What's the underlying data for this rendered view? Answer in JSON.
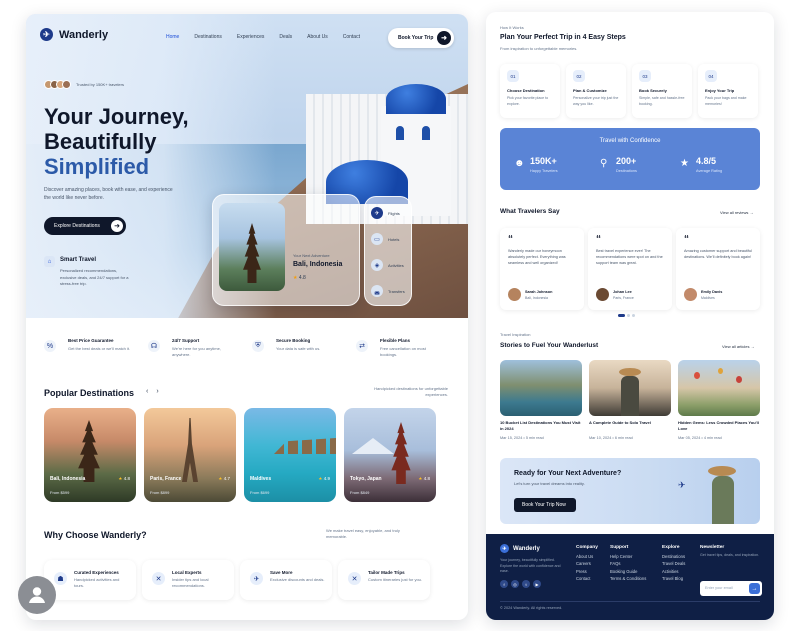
{
  "brand": {
    "name": "Wanderly",
    "accent": "#1e3a8a",
    "hero_accent": "#2c5aa8",
    "dark": "#0f172a",
    "footer_bg": "#0f1f45"
  },
  "nav": {
    "links": [
      "Home",
      "Destinations",
      "Experiences",
      "Deals",
      "About Us",
      "Contact"
    ],
    "cta": "Book Your Trip"
  },
  "hero": {
    "trusted": "Trusted by 150K+ travelers",
    "title_line1": "Your Journey,",
    "title_line2": "Beautifully",
    "title_accent": "Simplified",
    "subtitle": "Discover amazing places, book with ease, and experience the world like never before.",
    "button": "Explore Destinations"
  },
  "smart": {
    "title": "Smart Travel",
    "desc": "Personalized recommendations, exclusive deals, and 24/7 support for a stress-free trip."
  },
  "featured": {
    "label": "Your Next Adventure",
    "name": "Bali, Indonesia",
    "rating": "4.8"
  },
  "side_menu": [
    {
      "label": "Flights",
      "icon": "plane-icon"
    },
    {
      "label": "Hotels",
      "icon": "bed-icon"
    },
    {
      "label": "Activities",
      "icon": "ticket-icon"
    },
    {
      "label": "Transfers",
      "icon": "car-icon"
    }
  ],
  "features": [
    {
      "title": "Best Price Guarantee",
      "desc": "Get the best deals or we'll match it.",
      "icon": "%"
    },
    {
      "title": "24/7 Support",
      "desc": "We're here for you anytime, anywhere.",
      "icon": "☊"
    },
    {
      "title": "Secure Booking",
      "desc": "Your data is safe with us.",
      "icon": "⛨"
    },
    {
      "title": "Flexible Plans",
      "desc": "Free cancellation on most bookings.",
      "icon": "⇄"
    }
  ],
  "popular": {
    "title": "Popular Destinations",
    "note": "Handpicked destinations for unforgettable experiences.",
    "prev": "‹",
    "next": "›",
    "items": [
      {
        "name": "Bali, Indonesia",
        "price": "From $599",
        "rating": "4.8"
      },
      {
        "name": "Paris, France",
        "price": "From $899",
        "rating": "4.7"
      },
      {
        "name": "Maldives",
        "price": "From $699",
        "rating": "4.9"
      },
      {
        "name": "Tokyo, Japan",
        "price": "From $849",
        "rating": "4.8"
      }
    ]
  },
  "why": {
    "title": "Why Choose Wanderly?",
    "note": "We make travel easy, enjoyable, and truly memorable.",
    "items": [
      {
        "title": "Curated Experiences",
        "desc": "Handpicked activities and tours.",
        "icon": "☗"
      },
      {
        "title": "Local Experts",
        "desc": "Insider tips and local recommendations.",
        "icon": "✕"
      },
      {
        "title": "Save More",
        "desc": "Exclusive discounts and deals.",
        "icon": "✈"
      },
      {
        "title": "Tailor Made Trips",
        "desc": "Custom itineraries just for you.",
        "icon": "✕"
      }
    ]
  },
  "how": {
    "eyebrow": "How It Works",
    "title": "Plan Your Perfect Trip in 4 Easy Steps",
    "sub": "From inspiration to unforgettable memories.",
    "steps": [
      {
        "num": "01",
        "title": "Choose Destination",
        "desc": "Pick your favorite place to explore."
      },
      {
        "num": "02",
        "title": "Plan & Customize",
        "desc": "Personalize your trip just the way you like."
      },
      {
        "num": "03",
        "title": "Book Securely",
        "desc": "Simple, safe and hassle-free booking."
      },
      {
        "num": "04",
        "title": "Enjoy Your Trip",
        "desc": "Pack your bags and make memories!"
      }
    ]
  },
  "confidence": {
    "title": "Travel with Confidence",
    "stats": [
      {
        "value": "150K+",
        "label": "Happy Travelers",
        "icon": "👥"
      },
      {
        "value": "200+",
        "label": "Destinations",
        "icon": "⚲"
      },
      {
        "value": "4.8/5",
        "label": "Average Rating",
        "icon": "★"
      }
    ]
  },
  "testimonials": {
    "title": "What Travelers Say",
    "link": "View all reviews →",
    "items": [
      {
        "text": "Wanderly made our honeymoon absolutely perfect. Everything was seamless and well organized!",
        "name": "Sarah Johnson",
        "role": "Bali, Indonesia"
      },
      {
        "text": "Best travel experience ever! The recommendations were spot on and the support team was great.",
        "name": "Johan Lee",
        "role": "Paris, France"
      },
      {
        "text": "Amazing customer support and beautiful destinations. We'll definitely book again!",
        "name": "Emily Davis",
        "role": "Maldives"
      }
    ]
  },
  "stories": {
    "eyebrow": "Travel Inspiration",
    "title": "Stories to Fuel Your Wanderlust",
    "link": "View all articles →",
    "items": [
      {
        "title": "10 Bucket List Destinations You Must Visit in 2024",
        "meta": "Mar 15, 2024  •  5 min read"
      },
      {
        "title": "A Complete Guide to Solo Travel",
        "meta": "Mar 10, 2024  •  6 min read"
      },
      {
        "title": "Hidden Gems: Less Crowded Places You'll Love",
        "meta": "Mar 05, 2024  •  4 min read"
      }
    ]
  },
  "ready": {
    "title": "Ready for Your Next Adventure?",
    "desc": "Let's turn your travel dreams into reality.",
    "button": "Book Your Trip Now"
  },
  "footer": {
    "brand": "Wanderly",
    "tagline": "Your journey, beautifully simplified. Explore the world with confidence and ease.",
    "company": {
      "title": "Company",
      "links": [
        "About Us",
        "Careers",
        "Press",
        "Contact"
      ]
    },
    "support": {
      "title": "Support",
      "links": [
        "Help Center",
        "FAQs",
        "Booking Guide",
        "Terms & Conditions"
      ]
    },
    "explore": {
      "title": "Explore",
      "links": [
        "Destinations",
        "Travel Deals",
        "Activities",
        "Travel Blog"
      ]
    },
    "newsletter": {
      "title": "Newsletter",
      "desc": "Get travel tips, deals, and inspiration.",
      "placeholder": "Enter your email",
      "go": "→"
    },
    "copyright": "© 2024 Wanderly. All rights reserved."
  }
}
